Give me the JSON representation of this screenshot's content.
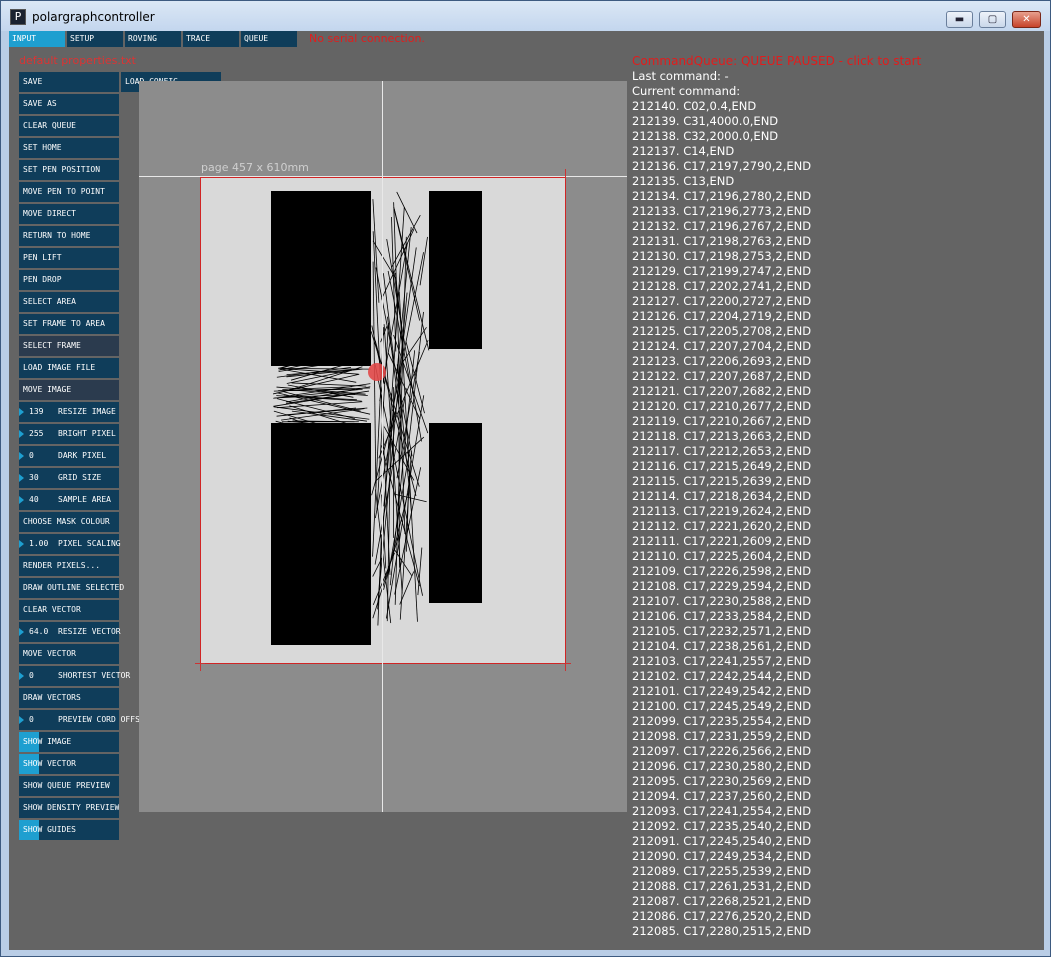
{
  "window": {
    "title": "polargraphcontroller",
    "app_icon_glyph": "P",
    "minimize_glyph": "▬",
    "maximize_glyph": "▢",
    "close_glyph": "✕"
  },
  "tabs": [
    {
      "label": "INPUT",
      "active": true
    },
    {
      "label": "SETUP",
      "active": false
    },
    {
      "label": "ROVING",
      "active": false
    },
    {
      "label": "TRACE",
      "active": false
    },
    {
      "label": "QUEUE",
      "active": false
    }
  ],
  "serial_status": "No serial connection.",
  "default_properties_label": "default properties.txt",
  "load_config_label": "LOAD CONFIG",
  "buttons": [
    {
      "label": "SAVE"
    },
    {
      "label": "SAVE AS"
    },
    {
      "label": "CLEAR QUEUE"
    },
    {
      "label": "SET HOME"
    },
    {
      "label": "SET PEN POSITION"
    },
    {
      "label": "MOVE PEN TO POINT"
    },
    {
      "label": "MOVE DIRECT"
    },
    {
      "label": "RETURN TO HOME"
    },
    {
      "label": "PEN LIFT"
    },
    {
      "label": "PEN DROP"
    },
    {
      "label": "SELECT AREA"
    },
    {
      "label": "SET FRAME TO AREA"
    },
    {
      "label": "SELECT FRAME",
      "dim": true
    },
    {
      "label": "LOAD IMAGE FILE"
    },
    {
      "label": "MOVE IMAGE",
      "dim": true
    },
    {
      "label": "RESIZE IMAGE",
      "value": "139"
    },
    {
      "label": "BRIGHT PIXEL",
      "value": "255"
    },
    {
      "label": "DARK PIXEL",
      "value": "0"
    },
    {
      "label": "GRID SIZE",
      "value": "30"
    },
    {
      "label": "SAMPLE AREA",
      "value": "40"
    },
    {
      "label": "CHOOSE MASK COLOUR"
    },
    {
      "label": "PIXEL SCALING",
      "value": "1.00"
    },
    {
      "label": "RENDER PIXELS..."
    },
    {
      "label": "DRAW OUTLINE SELECTED"
    },
    {
      "label": "CLEAR VECTOR"
    },
    {
      "label": "RESIZE VECTOR",
      "value": "64.0"
    },
    {
      "label": "MOVE VECTOR"
    },
    {
      "label": "SHORTEST VECTOR",
      "value": "0"
    },
    {
      "label": "DRAW VECTORS"
    },
    {
      "label": "PREVIEW CORD OFFSET",
      "value": "0"
    }
  ],
  "toggles": [
    {
      "label": "SHOW IMAGE",
      "on": true
    },
    {
      "label": "SHOW VECTOR",
      "on": true
    },
    {
      "label": "SHOW QUEUE PREVIEW",
      "on": false
    },
    {
      "label": "SHOW DENSITY PREVIEW",
      "on": false
    },
    {
      "label": "SHOW GUIDES",
      "on": true
    }
  ],
  "page_label": "page 457 x 610mm",
  "colors": {
    "accent": "#1e9fd0",
    "button": "#0f3d5a",
    "alert": "#e21c1c",
    "canvas": "#646464"
  },
  "queue": {
    "title": "CommandQueue: QUEUE PAUSED - click to start",
    "last_command": "Last command: -",
    "current_command": "Current command:",
    "items": [
      "212140. C02,0.4,END",
      "212139. C31,4000.0,END",
      "212138. C32,2000.0,END",
      "212137. C14,END",
      "212136. C17,2197,2790,2,END",
      "212135. C13,END",
      "212134. C17,2196,2780,2,END",
      "212133. C17,2196,2773,2,END",
      "212132. C17,2196,2767,2,END",
      "212131. C17,2198,2763,2,END",
      "212130. C17,2198,2753,2,END",
      "212129. C17,2199,2747,2,END",
      "212128. C17,2202,2741,2,END",
      "212127. C17,2200,2727,2,END",
      "212126. C17,2204,2719,2,END",
      "212125. C17,2205,2708,2,END",
      "212124. C17,2207,2704,2,END",
      "212123. C17,2206,2693,2,END",
      "212122. C17,2207,2687,2,END",
      "212121. C17,2207,2682,2,END",
      "212120. C17,2210,2677,2,END",
      "212119. C17,2210,2667,2,END",
      "212118. C17,2213,2663,2,END",
      "212117. C17,2212,2653,2,END",
      "212116. C17,2215,2649,2,END",
      "212115. C17,2215,2639,2,END",
      "212114. C17,2218,2634,2,END",
      "212113. C17,2219,2624,2,END",
      "212112. C17,2221,2620,2,END",
      "212111. C17,2221,2609,2,END",
      "212110. C17,2225,2604,2,END",
      "212109. C17,2226,2598,2,END",
      "212108. C17,2229,2594,2,END",
      "212107. C17,2230,2588,2,END",
      "212106. C17,2233,2584,2,END",
      "212105. C17,2232,2571,2,END",
      "212104. C17,2238,2561,2,END",
      "212103. C17,2241,2557,2,END",
      "212102. C17,2242,2544,2,END",
      "212101. C17,2249,2542,2,END",
      "212100. C17,2245,2549,2,END",
      "212099. C17,2235,2554,2,END",
      "212098. C17,2231,2559,2,END",
      "212097. C17,2226,2566,2,END",
      "212096. C17,2230,2580,2,END",
      "212095. C17,2230,2569,2,END",
      "212094. C17,2237,2560,2,END",
      "212093. C17,2241,2554,2,END",
      "212092. C17,2235,2540,2,END",
      "212091. C17,2245,2540,2,END",
      "212090. C17,2249,2534,2,END",
      "212089. C17,2255,2539,2,END",
      "212088. C17,2261,2531,2,END",
      "212087. C17,2268,2521,2,END",
      "212086. C17,2276,2520,2,END",
      "212085. C17,2280,2515,2,END"
    ]
  }
}
